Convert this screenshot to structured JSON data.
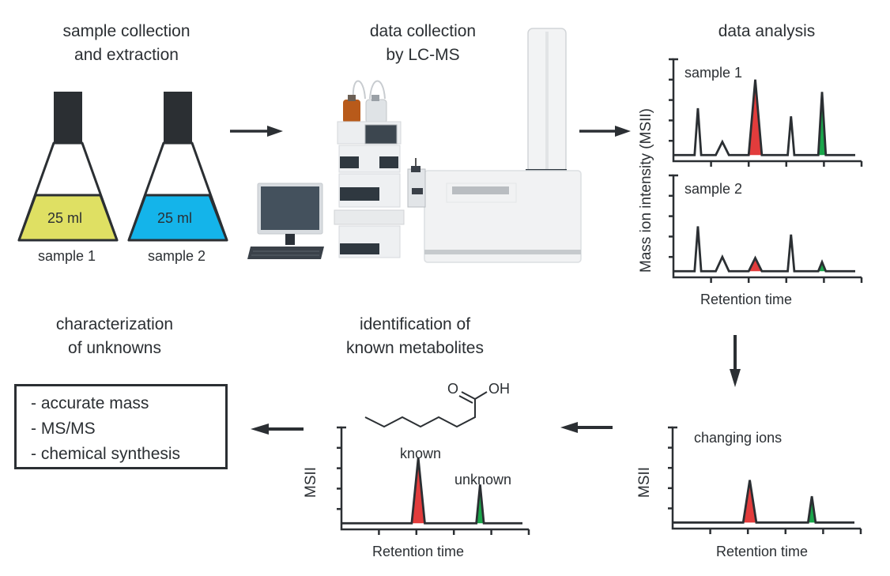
{
  "colors": {
    "ink": "#2b2f33",
    "known_peak": "#e23c3c",
    "unknown_peak": "#1aa64a",
    "sample1_liquid": "#dfe063",
    "sample2_liquid": "#14b4ea"
  },
  "steps": {
    "collection": {
      "title_line1": "sample collection",
      "title_line2": "and extraction"
    },
    "lcms": {
      "title_line1": "data collection",
      "title_line2": "by LC-MS"
    },
    "analysis": {
      "title": "data analysis"
    },
    "identification": {
      "title_line1": "identification of",
      "title_line2": "known metabolites"
    },
    "characterization": {
      "title_line1": "characterization",
      "title_line2": "of unknowns"
    }
  },
  "flasks": [
    {
      "volume": "25 ml",
      "label": "sample 1",
      "liquid": "yellow"
    },
    {
      "volume": "25 ml",
      "label": "sample 2",
      "liquid": "blue"
    }
  ],
  "characterization_methods": [
    "- accurate mass",
    "- MS/MS",
    "- chemical synthesis"
  ],
  "molecule": {
    "name": "octanoic acid",
    "labels": {
      "oxygen": "O",
      "hydroxyl": "OH"
    }
  },
  "icons": {
    "flow_arrows": [
      "arrow-right",
      "arrow-right",
      "arrow-down",
      "arrow-left",
      "arrow-left"
    ],
    "instrument": "lc-ms-instrument",
    "computer": "computer-monitor"
  },
  "chart_data": [
    {
      "type": "line",
      "title": "sample 1",
      "ylabel": "Mass ion intensity (MSII)",
      "xlabel": "",
      "x_ticks": 5,
      "y_ticks": 5,
      "baseline": 0.3,
      "ylim": [
        0,
        5
      ],
      "peaks": [
        {
          "x": 0.13,
          "height": 2.3,
          "width": 0.035,
          "fill": "none"
        },
        {
          "x": 0.26,
          "height": 0.65,
          "width": 0.07,
          "fill": "none"
        },
        {
          "x": 0.435,
          "height": 3.7,
          "width": 0.07,
          "fill": "known"
        },
        {
          "x": 0.625,
          "height": 1.9,
          "width": 0.035,
          "fill": "none"
        },
        {
          "x": 0.79,
          "height": 3.1,
          "width": 0.04,
          "fill": "unknown"
        }
      ]
    },
    {
      "type": "line",
      "title": "sample 2",
      "ylabel": "Mass ion intensity (MSII)",
      "xlabel": "Retention time",
      "x_ticks": 5,
      "y_ticks": 5,
      "baseline": 0.3,
      "ylim": [
        0,
        5
      ],
      "peaks": [
        {
          "x": 0.13,
          "height": 2.2,
          "width": 0.035,
          "fill": "none"
        },
        {
          "x": 0.26,
          "height": 0.7,
          "width": 0.07,
          "fill": "none"
        },
        {
          "x": 0.435,
          "height": 0.65,
          "width": 0.07,
          "fill": "known"
        },
        {
          "x": 0.625,
          "height": 1.8,
          "width": 0.035,
          "fill": "none"
        },
        {
          "x": 0.79,
          "height": 0.45,
          "width": 0.04,
          "fill": "unknown"
        }
      ]
    },
    {
      "type": "line",
      "title": "changing ions",
      "ylabel": "MSII",
      "xlabel": "Retention time",
      "x_ticks": 5,
      "y_ticks": 5,
      "baseline": 0.3,
      "ylim": [
        0,
        5
      ],
      "peaks": [
        {
          "x": 0.41,
          "height": 2.1,
          "width": 0.07,
          "fill": "known"
        },
        {
          "x": 0.74,
          "height": 1.3,
          "width": 0.04,
          "fill": "unknown"
        }
      ]
    },
    {
      "type": "line",
      "title": "",
      "ylabel": "MSII",
      "xlabel": "Retention time",
      "x_ticks": 5,
      "y_ticks": 5,
      "baseline": 0.3,
      "ylim": [
        0,
        5
      ],
      "annotations": [
        "known",
        "unknown"
      ],
      "peaks": [
        {
          "x": 0.41,
          "height": 3.2,
          "width": 0.07,
          "fill": "known",
          "label": "known"
        },
        {
          "x": 0.74,
          "height": 1.9,
          "width": 0.04,
          "fill": "unknown",
          "label": "unknown"
        }
      ]
    }
  ]
}
